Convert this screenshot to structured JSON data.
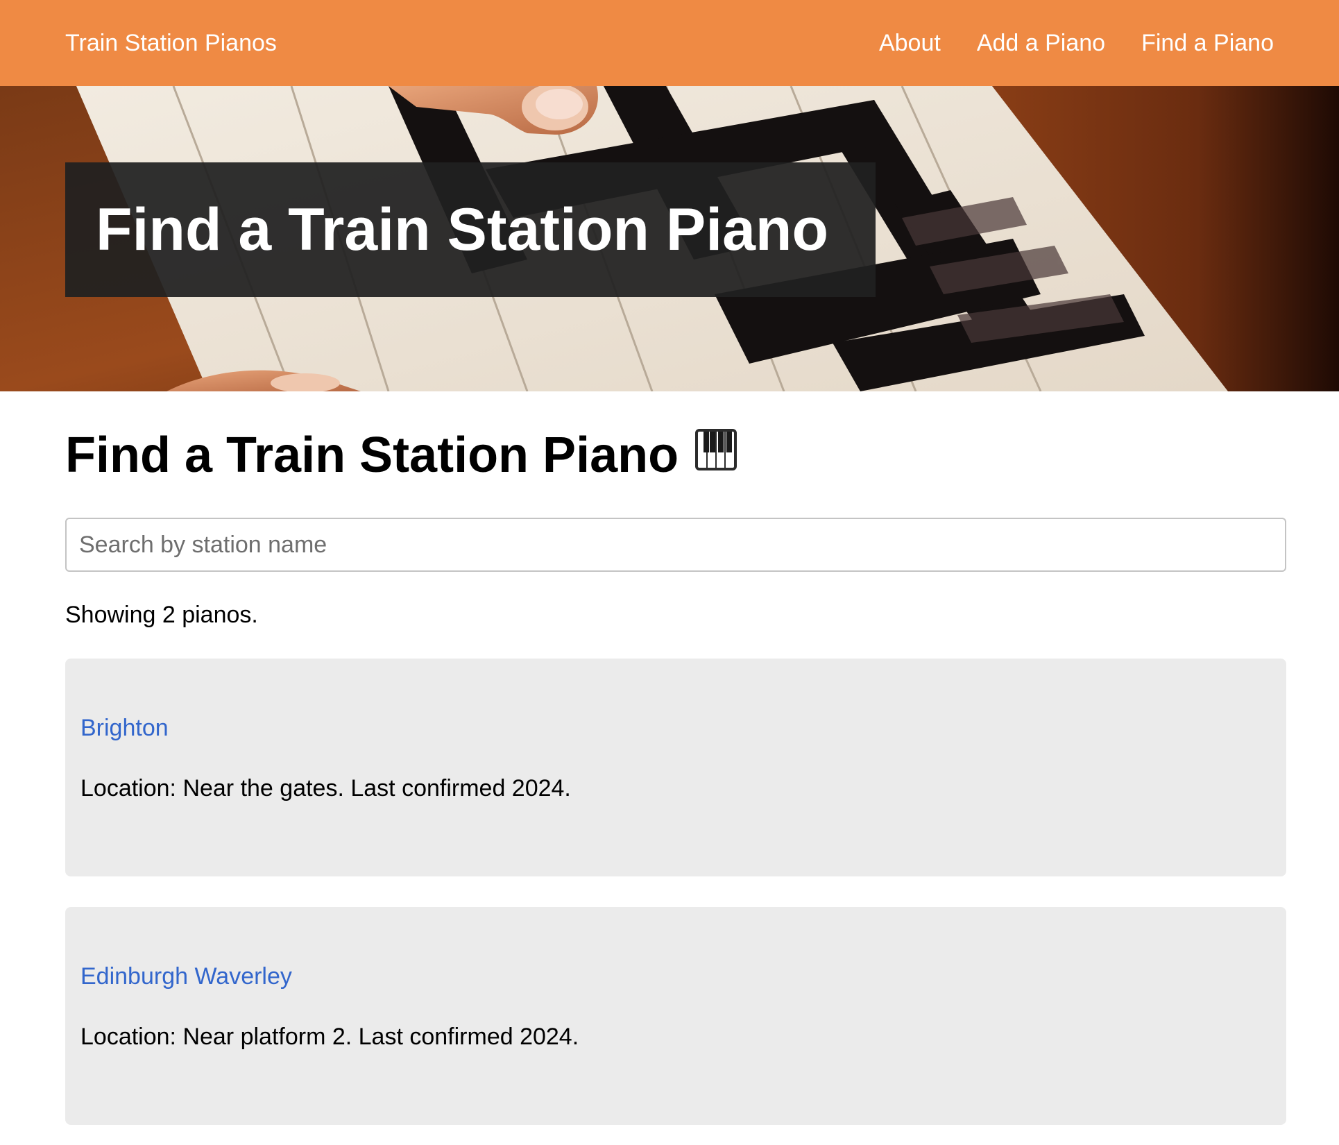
{
  "header": {
    "brand": "Train Station Pianos",
    "nav": [
      {
        "label": "About"
      },
      {
        "label": "Add a Piano"
      },
      {
        "label": "Find a Piano"
      }
    ]
  },
  "hero": {
    "title": "Find a Train Station Piano"
  },
  "main": {
    "title": "Find a Train Station Piano",
    "title_icon": "piano-keyboard-emoji",
    "search": {
      "placeholder": "Search by station name",
      "value": ""
    },
    "results_count": "Showing 2 pianos.",
    "pianos": [
      {
        "station": "Brighton",
        "location": "Location: Near the gates. Last confirmed 2024."
      },
      {
        "station": "Edinburgh Waverley",
        "location": "Location: Near platform 2. Last confirmed 2024."
      }
    ]
  },
  "colors": {
    "header_bg": "#ef8a44",
    "link": "#3266cc",
    "card_bg": "#ebebeb",
    "banner_bg": "#202020"
  }
}
